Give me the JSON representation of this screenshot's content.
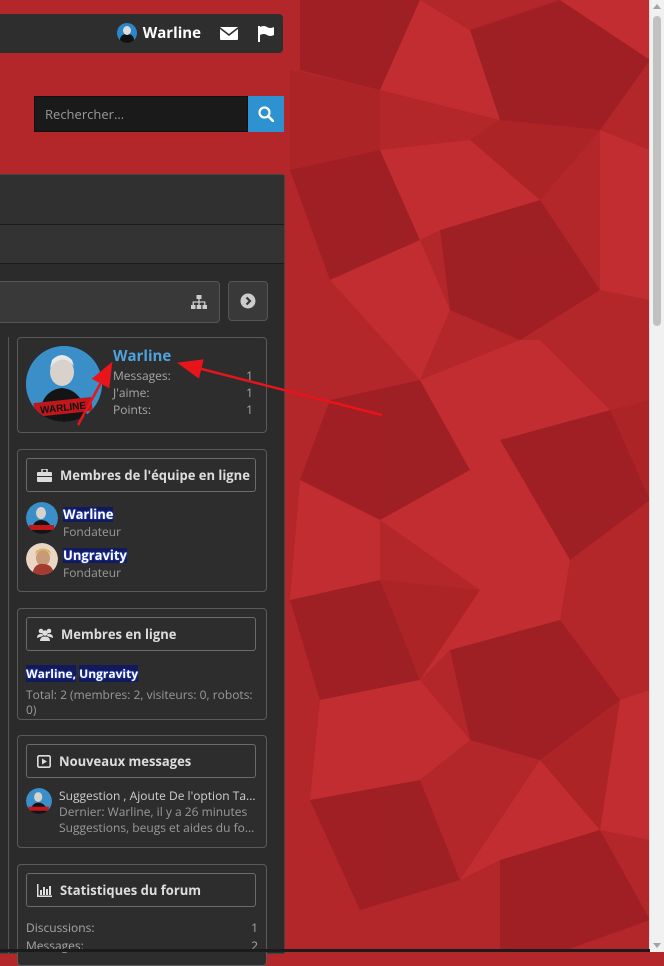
{
  "header": {
    "username": "Warline"
  },
  "search": {
    "placeholder": "Rechercher..."
  },
  "profile": {
    "name": "Warline",
    "stats": [
      {
        "label": "Messages:",
        "value": "1"
      },
      {
        "label": "J'aime:",
        "value": "1"
      },
      {
        "label": "Points:",
        "value": "1"
      }
    ]
  },
  "staff_online": {
    "title": "Membres de l'équipe en ligne",
    "members": [
      {
        "name": "Warline",
        "role": "Fondateur"
      },
      {
        "name": "Ungravity",
        "role": "Fondateur"
      }
    ]
  },
  "members_online": {
    "title": "Membres en ligne",
    "name1": "Warline",
    "separator": ",",
    "name2": "Ungravity",
    "total": "Total: 2 (membres: 2, visiteurs: 0, robots: 0)"
  },
  "new_posts": {
    "title": "Nouveaux messages",
    "post_title": "Suggestion , Ajoute De l'option Ta...",
    "last": "Dernier: Warline, il y a 26 minutes",
    "forum": "Suggestions, beugs et aides du fo..."
  },
  "forum_stats": {
    "title": "Statistiques du forum",
    "rows": [
      {
        "label": "Discussions:",
        "value": "1"
      },
      {
        "label": "Messages:",
        "value": "2"
      }
    ]
  },
  "colors": {
    "background": "#b3262a",
    "panel": "#2b2b2b",
    "link": "#4ea3dd",
    "search_button": "#2f92d0"
  }
}
